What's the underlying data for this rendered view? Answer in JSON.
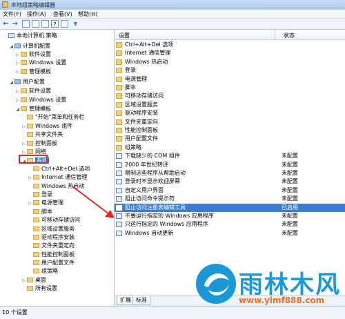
{
  "window": {
    "title": "本地组策略编辑器"
  },
  "menu": [
    "文件(F)",
    "操作(A)",
    "查看(V)",
    "帮助(H)"
  ],
  "tree": [
    {
      "label": "本地计算机 策略",
      "icon": "doc",
      "level": 0,
      "exp": ""
    },
    {
      "label": "计算机配置",
      "icon": "comp",
      "level": 1,
      "exp": "◢"
    },
    {
      "label": "软件设置",
      "icon": "folder",
      "level": 2,
      "exp": "▷"
    },
    {
      "label": "Windows 设置",
      "icon": "folder",
      "level": 2,
      "exp": "▷"
    },
    {
      "label": "管理模板",
      "icon": "folder",
      "level": 2,
      "exp": "▷"
    },
    {
      "label": "用户配置",
      "icon": "comp",
      "level": 1,
      "exp": "◢"
    },
    {
      "label": "软件设置",
      "icon": "folder",
      "level": 2,
      "exp": "▷"
    },
    {
      "label": "Windows 设置",
      "icon": "folder",
      "level": 2,
      "exp": "▷"
    },
    {
      "label": "管理模板",
      "icon": "folder",
      "level": 2,
      "exp": "◢"
    },
    {
      "label": "\"开始\"菜单和任务栏",
      "icon": "folder",
      "level": 3,
      "exp": ""
    },
    {
      "label": "Windows 组件",
      "icon": "folder",
      "level": 3,
      "exp": "▷"
    },
    {
      "label": "共享文件夹",
      "icon": "folder",
      "level": 3,
      "exp": ""
    },
    {
      "label": "控制面板",
      "icon": "folder",
      "level": 3,
      "exp": "▷"
    },
    {
      "label": "网络",
      "icon": "folder",
      "level": 3,
      "exp": "▷"
    },
    {
      "label": "系统",
      "icon": "folder",
      "level": 3,
      "exp": "◢",
      "selected": true
    },
    {
      "label": "Ctrl+Alt+Del 选项",
      "icon": "folder",
      "level": 4,
      "exp": ""
    },
    {
      "label": "Internet 通信管理",
      "icon": "folder",
      "level": 4,
      "exp": "▷"
    },
    {
      "label": "Windows 热启动",
      "icon": "folder",
      "level": 4,
      "exp": ""
    },
    {
      "label": "登录",
      "icon": "folder",
      "level": 4,
      "exp": ""
    },
    {
      "label": "电源管理",
      "icon": "folder",
      "level": 4,
      "exp": "▷"
    },
    {
      "label": "脚本",
      "icon": "folder",
      "level": 4,
      "exp": ""
    },
    {
      "label": "可移动存储访问",
      "icon": "folder",
      "level": 4,
      "exp": ""
    },
    {
      "label": "区域设置服务",
      "icon": "folder",
      "level": 4,
      "exp": ""
    },
    {
      "label": "驱动程序安装",
      "icon": "folder",
      "level": 4,
      "exp": ""
    },
    {
      "label": "文件夹重定向",
      "icon": "folder",
      "level": 4,
      "exp": ""
    },
    {
      "label": "性能控制面板",
      "icon": "folder",
      "level": 4,
      "exp": ""
    },
    {
      "label": "用户配置文件",
      "icon": "folder",
      "level": 4,
      "exp": ""
    },
    {
      "label": "组策略",
      "icon": "folder",
      "level": 4,
      "exp": ""
    },
    {
      "label": "桌面",
      "icon": "folder",
      "level": 3,
      "exp": "▷"
    },
    {
      "label": "所有设置",
      "icon": "folder",
      "level": 3,
      "exp": ""
    }
  ],
  "columns": {
    "setting": "设置",
    "state": "状态"
  },
  "rows": [
    {
      "name": "Ctrl+Alt+Del 选项",
      "state": "",
      "icon": "folder"
    },
    {
      "name": "Internet 通信管理",
      "state": "",
      "icon": "folder"
    },
    {
      "name": "Windows 热启动",
      "state": "",
      "icon": "folder"
    },
    {
      "name": "登录",
      "state": "",
      "icon": "folder"
    },
    {
      "name": "电源管理",
      "state": "",
      "icon": "folder"
    },
    {
      "name": "脚本",
      "state": "",
      "icon": "folder"
    },
    {
      "name": "可移动存储访问",
      "state": "",
      "icon": "folder"
    },
    {
      "name": "区域设置服务",
      "state": "",
      "icon": "folder"
    },
    {
      "name": "驱动程序安装",
      "state": "",
      "icon": "folder"
    },
    {
      "name": "文件夹重定向",
      "state": "",
      "icon": "folder"
    },
    {
      "name": "性能控制面板",
      "state": "",
      "icon": "folder"
    },
    {
      "name": "用户配置文件",
      "state": "",
      "icon": "folder"
    },
    {
      "name": "组策略",
      "state": "",
      "icon": "folder"
    },
    {
      "name": "下载缺少的 COM 组件",
      "state": "未配置",
      "icon": "setting"
    },
    {
      "name": "2000 年世纪转译",
      "state": "未配置",
      "icon": "setting"
    },
    {
      "name": "限制这些程序从帮助启动",
      "state": "未配置",
      "icon": "setting"
    },
    {
      "name": "登录时不显示欢迎屏幕",
      "state": "未配置",
      "icon": "setting"
    },
    {
      "name": "自定义用户界面",
      "state": "未配置",
      "icon": "setting"
    },
    {
      "name": "阻止访问命令提示符",
      "state": "未配置",
      "icon": "setting"
    },
    {
      "name": "阻止访问注册表编辑工具",
      "state": "已启用",
      "icon": "setting",
      "selected": true
    },
    {
      "name": "不要运行指定的 Windows 应用程序",
      "state": "未配置",
      "icon": "setting"
    },
    {
      "name": "只运行指定的 Windows 应用程序",
      "state": "未配置",
      "icon": "setting"
    },
    {
      "name": "Windows 自动更新",
      "state": "未配置",
      "icon": "setting"
    }
  ],
  "tabs": [
    "扩展",
    "标准"
  ],
  "status": "10 个设置",
  "watermark": {
    "brand": "雨林木风",
    "url": "www.ylmf888.com"
  },
  "colors": {
    "highlight_box": "#e8242b",
    "selection": "#3d7bd6",
    "brand": "#1a98d8",
    "url": "#e8732b"
  }
}
